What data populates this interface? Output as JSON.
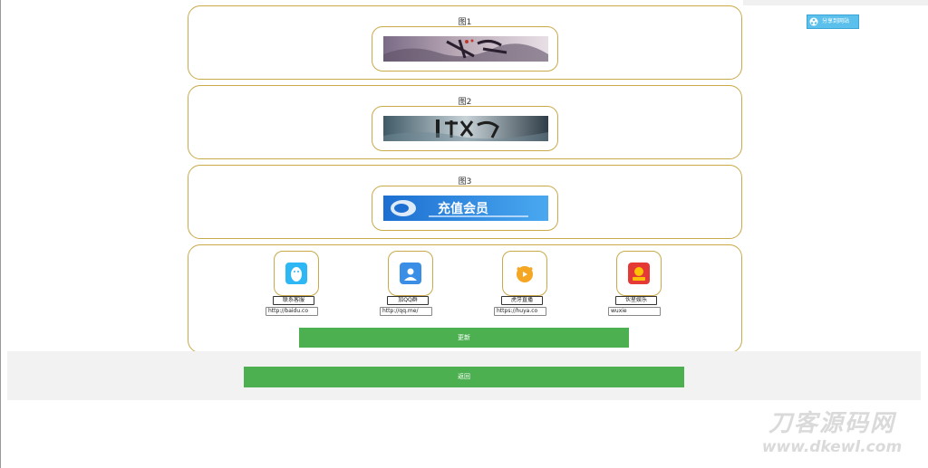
{
  "share": {
    "label": "分享到网站",
    "icon": "share-icon",
    "color": "#5bc0eb"
  },
  "panels": [
    {
      "title": "图1",
      "banner": "banner-1"
    },
    {
      "title": "图2",
      "banner": "banner-2"
    },
    {
      "title": "图3",
      "banner": "banner-3",
      "banner_text": "充值会员"
    }
  ],
  "apps": [
    {
      "name": "联系客服",
      "url": "http://baidu.co",
      "icon": "qq-penguin-icon",
      "color": "#2db7f5"
    },
    {
      "name": "加QQ群",
      "url": "http://qq.me/",
      "icon": "qq-group-icon",
      "color": "#3a8ee6"
    },
    {
      "name": "虎牙直播",
      "url": "https://huya.co",
      "icon": "huya-tiger-icon",
      "color": "#f5a623"
    },
    {
      "name": "伙星娱乐",
      "url": "wuxie",
      "icon": "red-app-icon",
      "color": "#e53935"
    }
  ],
  "buttons": {
    "inner": "更新",
    "footer": "返回"
  },
  "colors": {
    "accent": "#4caf50",
    "border": "#c9a94a",
    "footer_bg": "#f2f2f2"
  },
  "watermark": {
    "line1": "刀客源码网",
    "line2": "www.dkewl.com"
  }
}
